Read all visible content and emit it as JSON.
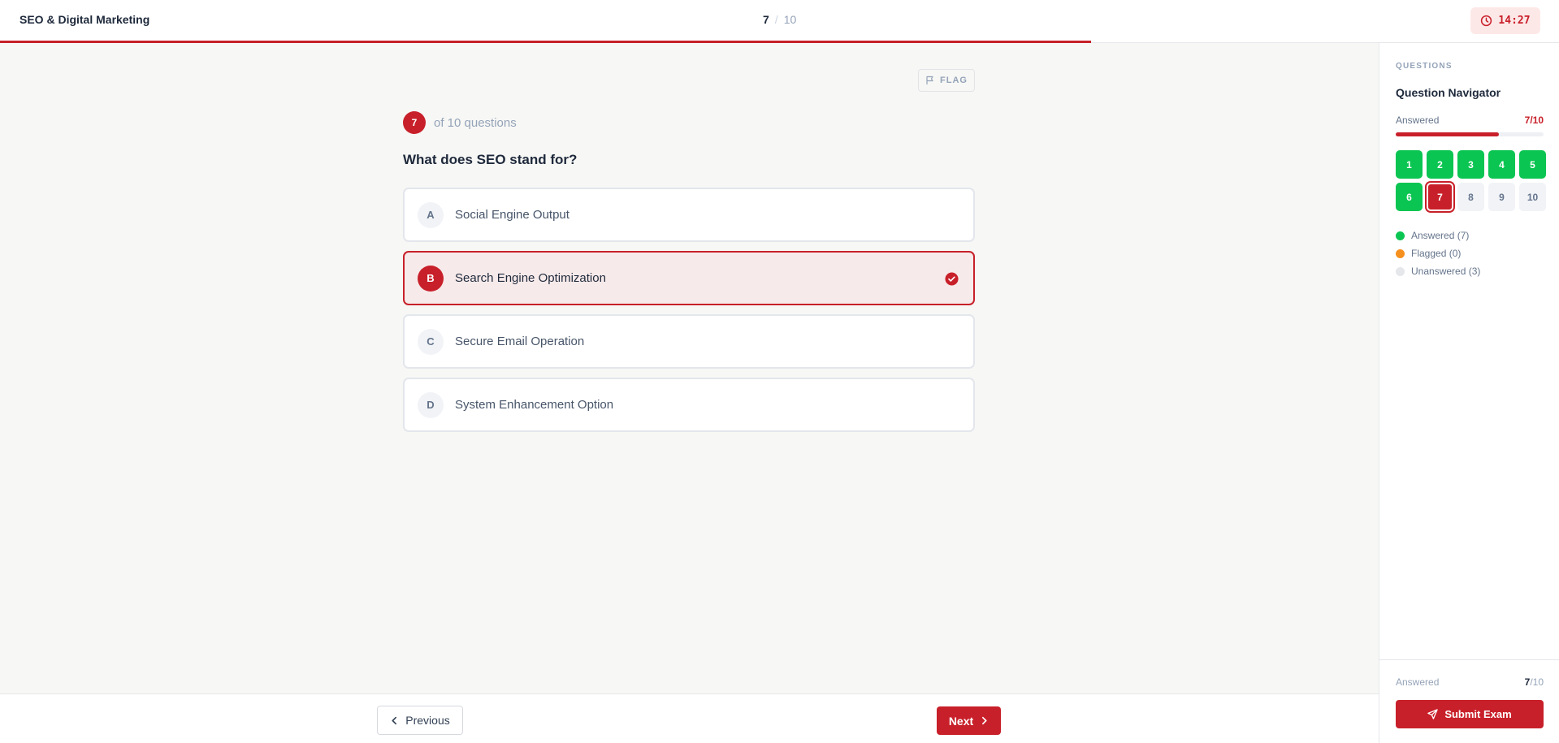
{
  "header": {
    "title": "SEO & Digital Marketing",
    "current": "7",
    "separator": "/",
    "total": "10",
    "timer": "14:27",
    "progress_fraction": 0.7
  },
  "question": {
    "flag_label": "FLAG",
    "number": "7",
    "of_text": "of 10 questions",
    "text": "What does SEO stand for?",
    "options": [
      {
        "letter": "A",
        "text": "Social Engine Output",
        "selected": false
      },
      {
        "letter": "B",
        "text": "Search Engine Optimization",
        "selected": true
      },
      {
        "letter": "C",
        "text": "Secure Email Operation",
        "selected": false
      },
      {
        "letter": "D",
        "text": "System Enhancement Option",
        "selected": false
      }
    ]
  },
  "footer": {
    "previous_label": "Previous",
    "next_label": "Next"
  },
  "sidebar": {
    "section_label": "QUESTIONS",
    "title": "Question Navigator",
    "answered_label": "Answered",
    "answered_value": "7/10",
    "answered_fraction": 0.7,
    "questions": [
      {
        "num": "1",
        "state": "answered"
      },
      {
        "num": "2",
        "state": "answered"
      },
      {
        "num": "3",
        "state": "answered"
      },
      {
        "num": "4",
        "state": "answered"
      },
      {
        "num": "5",
        "state": "answered"
      },
      {
        "num": "6",
        "state": "answered"
      },
      {
        "num": "7",
        "state": "current"
      },
      {
        "num": "8",
        "state": "unanswered"
      },
      {
        "num": "9",
        "state": "unanswered"
      },
      {
        "num": "10",
        "state": "unanswered"
      }
    ],
    "legend": [
      {
        "label": "Answered (7)",
        "color": "#0bc552"
      },
      {
        "label": "Flagged (0)",
        "color": "#f5901e"
      },
      {
        "label": "Unanswered (3)",
        "color": "#e5e7eb"
      }
    ],
    "footer_label": "Answered",
    "footer_count": "7",
    "footer_total": "/10",
    "submit_label": "Submit Exam"
  },
  "colors": {
    "accent": "#c8202a",
    "answered": "#0bc552",
    "flagged": "#f5901e"
  }
}
